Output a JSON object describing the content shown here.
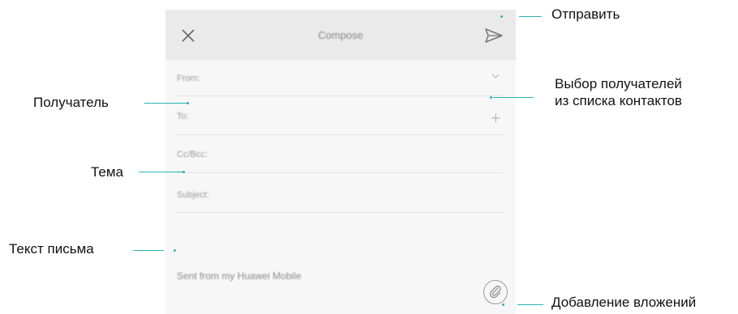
{
  "compose": {
    "title": "Compose",
    "from_label": "From:",
    "to_label": "To:",
    "ccbcc_label": "Cc/Bcc:",
    "subject_label": "Subject:",
    "signature": "Sent from my Huawei Mobile",
    "icons": {
      "close": "close-icon",
      "send": "send-icon",
      "dropdown": "chevron-down-icon",
      "add": "plus-icon",
      "attach": "paperclip-icon"
    }
  },
  "annotations": {
    "send": "Отправить",
    "choose_recipients_line1": "Выбор получателей",
    "choose_recipients_line2": "из списка контактов",
    "recipient": "Получатель",
    "subject": "Тема",
    "body": "Текст письма",
    "attachments": "Добавление вложений"
  },
  "colors": {
    "accent": "#2bb3b3",
    "topbar": "#eaeaea",
    "screen": "#f7f7f7"
  }
}
